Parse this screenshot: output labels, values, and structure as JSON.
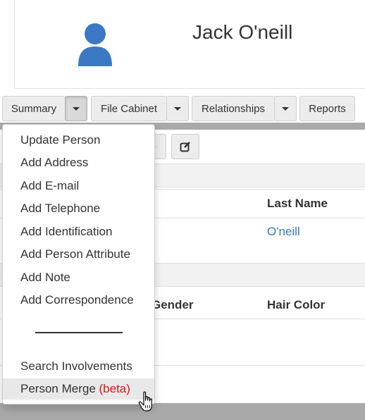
{
  "profile": {
    "name": "Jack O'neill"
  },
  "tabs": {
    "summary": "Summary",
    "file_cabinet": "File Cabinet",
    "relationships": "Relationships",
    "reports": "Reports"
  },
  "table1": {
    "last_name_header": "Last Name",
    "last_name_value": "O'neill"
  },
  "table2": {
    "gender_header": "Gender",
    "hair_color_header": "Hair Color"
  },
  "menu": {
    "items": [
      "Update Person",
      "Add Address",
      "Add E-mail",
      "Add Telephone",
      "Add Identification",
      "Add Person Attribute",
      "Add Note",
      "Add Correspondence",
      "Search Involvements"
    ],
    "merge_label": "Person Merge",
    "merge_badge": "(beta)"
  },
  "colors": {
    "link": "#337ab7",
    "beta": "#d9141b",
    "avatar": "#3a7bd5"
  }
}
